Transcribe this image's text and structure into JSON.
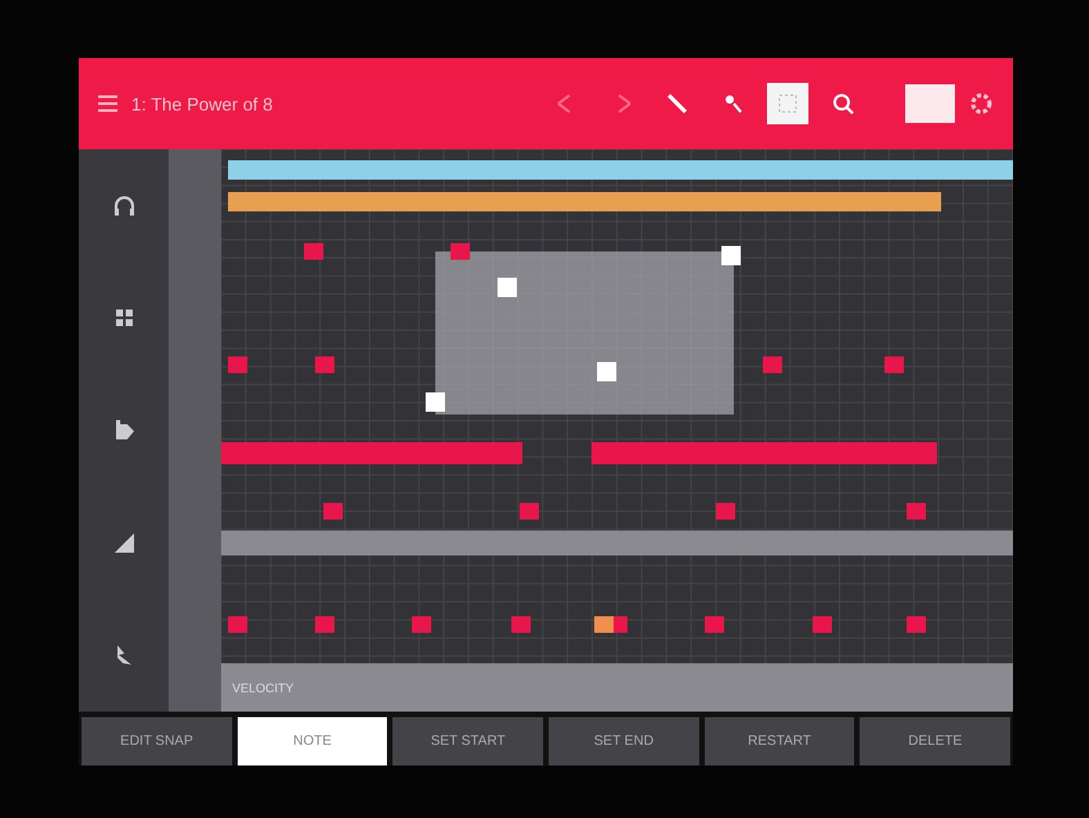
{
  "header": {
    "title": "1: The Power of 8",
    "tools": [
      {
        "kind": "undo",
        "selected": false
      },
      {
        "kind": "redo",
        "selected": false
      },
      {
        "kind": "pencil",
        "selected": false
      },
      {
        "kind": "brush",
        "selected": false
      },
      {
        "kind": "select",
        "selected": true
      },
      {
        "kind": "zoom",
        "selected": false
      }
    ]
  },
  "sidebar": {
    "items": [
      {
        "kind": "headphones",
        "selected": false
      },
      {
        "kind": "grid",
        "selected": false
      },
      {
        "kind": "folder",
        "selected": false
      },
      {
        "kind": "meter",
        "selected": false
      },
      {
        "kind": "tools",
        "selected": false
      }
    ]
  },
  "lane": {
    "label": "VELOCITY"
  },
  "tabs": [
    {
      "label": "EDIT SNAP",
      "selected": false
    },
    {
      "label": "NOTE",
      "selected": true
    },
    {
      "label": "SET START",
      "selected": false
    },
    {
      "label": "SET END",
      "selected": false
    },
    {
      "label": "RESTART",
      "selected": false
    },
    {
      "label": "DELETE",
      "selected": false
    }
  ]
}
